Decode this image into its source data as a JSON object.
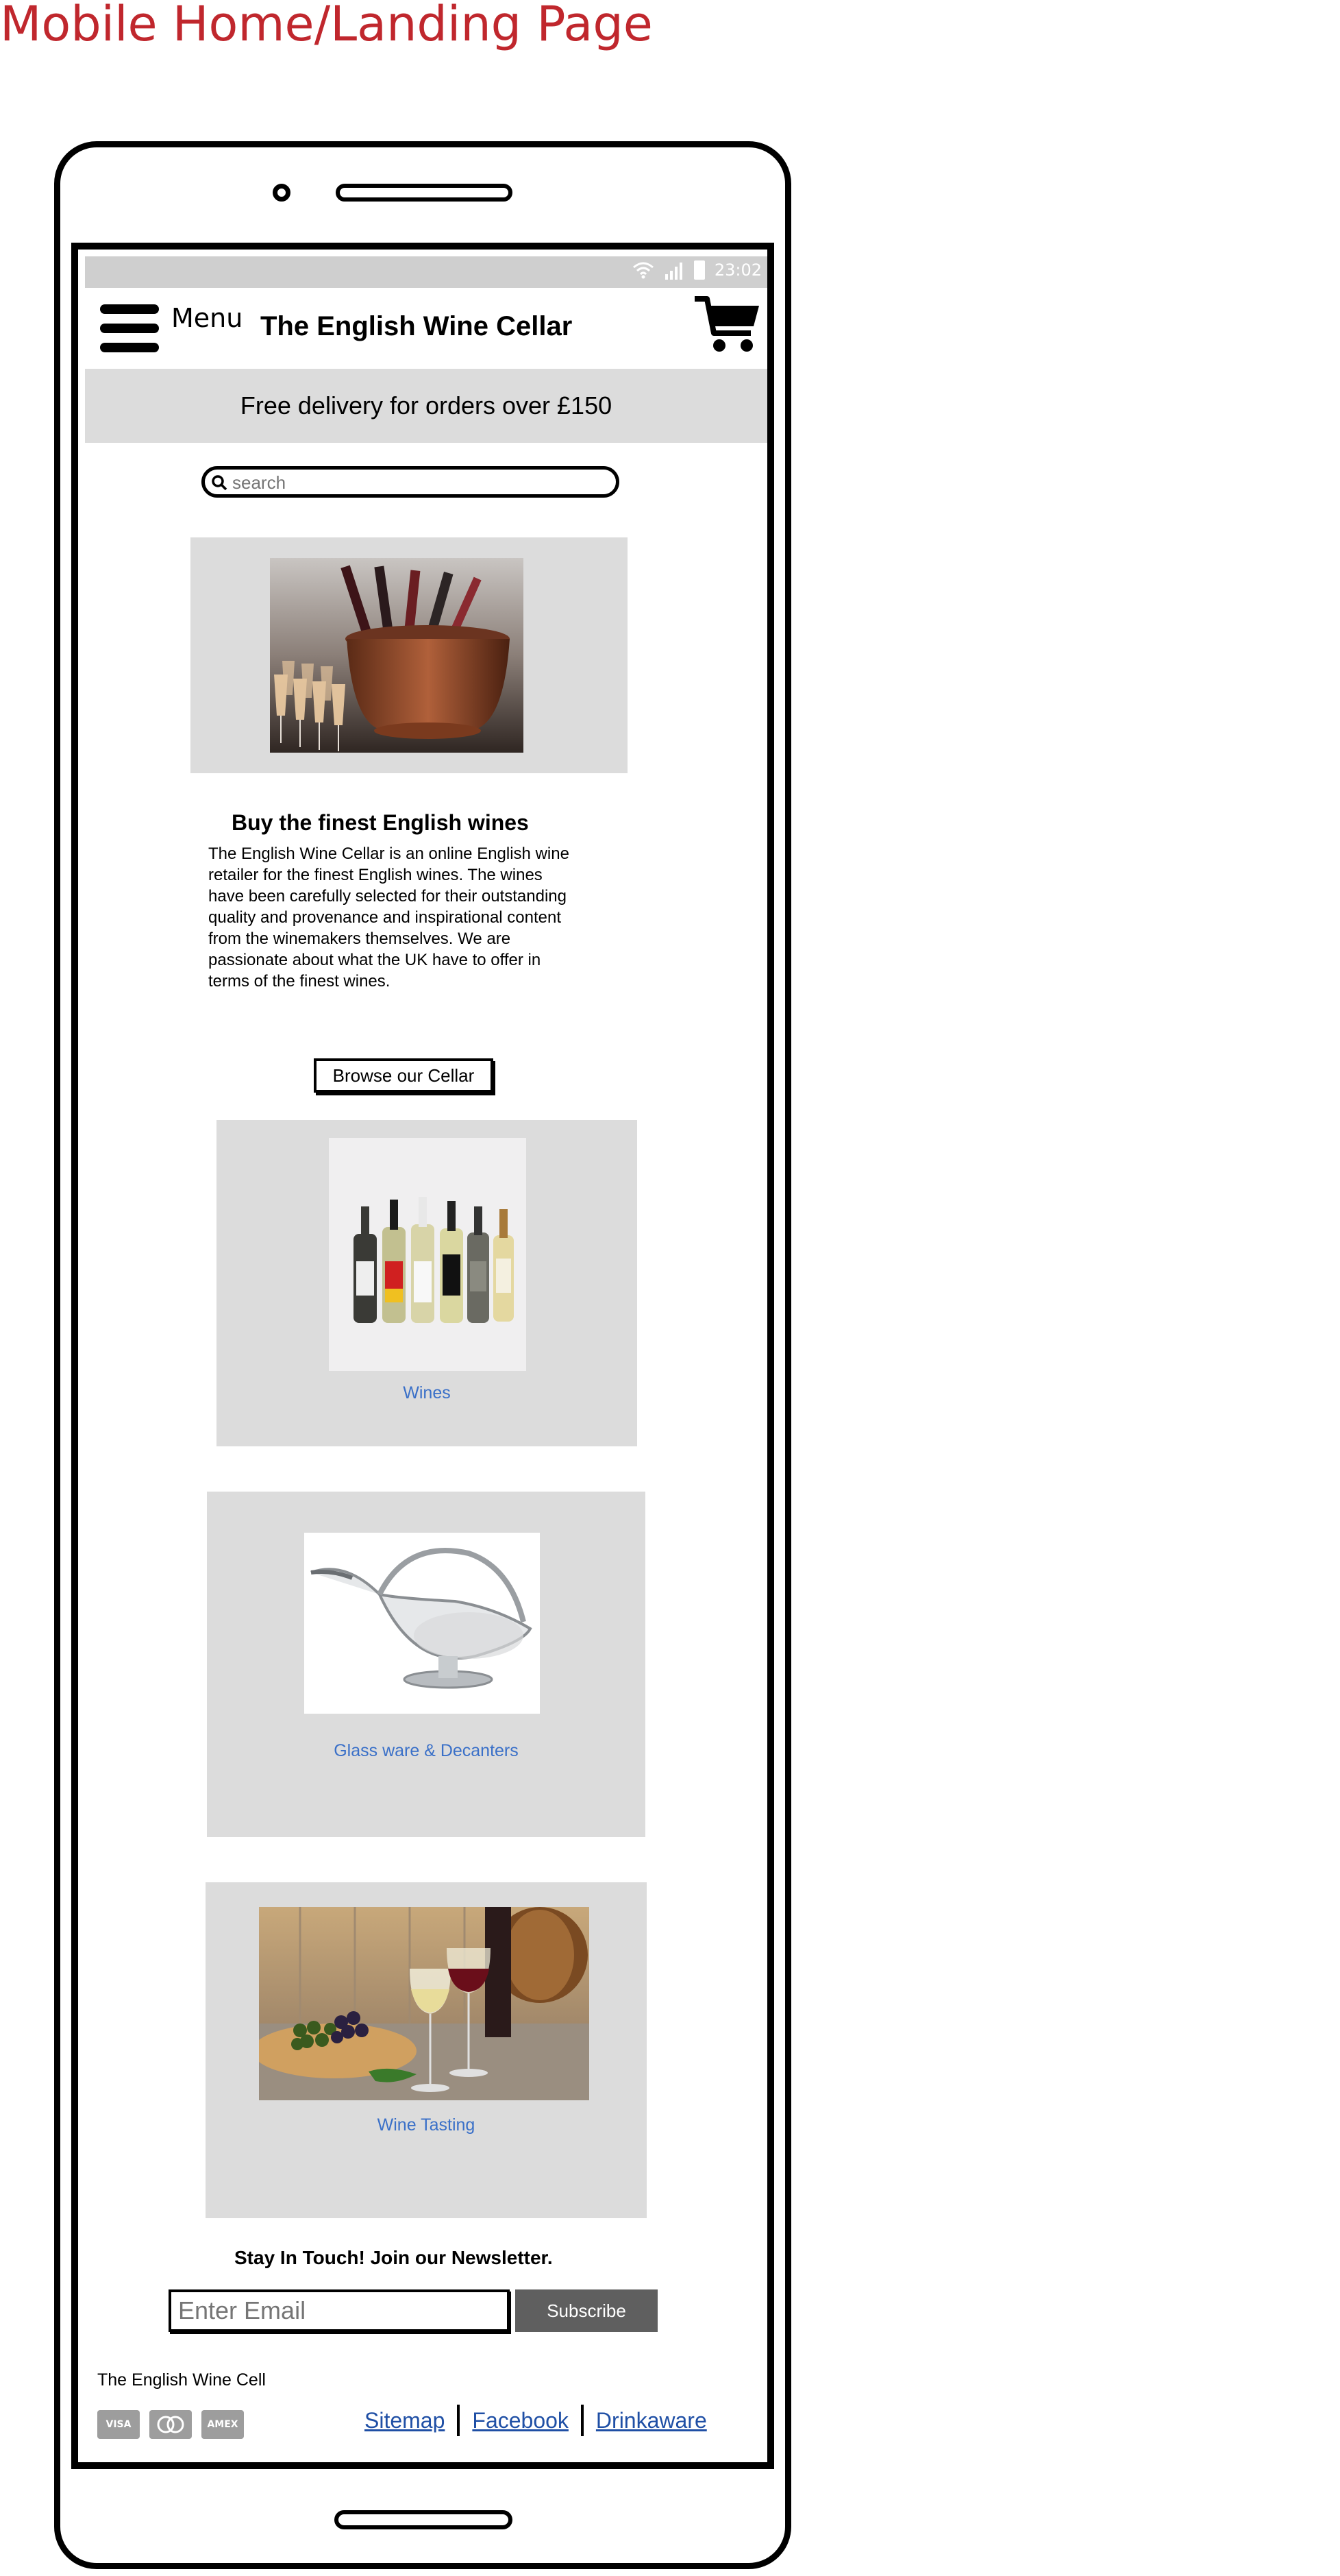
{
  "page_heading": "Mobile Home/Landing Page",
  "status_bar": {
    "time": "23:02"
  },
  "header": {
    "menu_label": "Menu",
    "site_title": "The English Wine Cellar"
  },
  "banner": {
    "text": "Free delivery for orders over £150"
  },
  "search": {
    "placeholder": "search"
  },
  "intro": {
    "heading": "Buy the finest English wines",
    "body": "The English Wine Cellar is an online English wine retailer for the finest English wines. The wines have been carefully selected for their outstanding quality and provenance and inspirational content from the winemakers themselves. We are passionate about what the UK have to offer in terms of the finest wines."
  },
  "browse_button": "Browse our Cellar",
  "categories": [
    {
      "label": "Wines"
    },
    {
      "label": "Glass ware & Decanters"
    },
    {
      "label": "Wine Tasting"
    }
  ],
  "newsletter": {
    "heading": "Stay In Touch! Join our Newsletter.",
    "email_placeholder": "Enter Email",
    "subscribe_label": "Subscribe"
  },
  "footer": {
    "brand": "The English Wine Cell",
    "payment_icons": [
      "visa-icon",
      "mastercard-icon",
      "amex-icon"
    ],
    "links": [
      "Sitemap",
      "Facebook",
      "Drinkaware"
    ]
  },
  "colors": {
    "heading_red": "#c0272d",
    "link_blue": "#3a70c8",
    "panel_gray": "#dcdcdc",
    "subscribe_gray": "#5f5f5f"
  }
}
